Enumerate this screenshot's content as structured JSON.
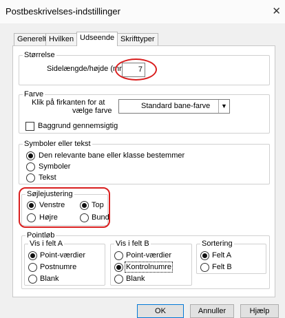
{
  "window": {
    "title": "Postbeskrivelses-indstillinger",
    "close_glyph": "✕"
  },
  "tabs": [
    {
      "label": "Generelt",
      "active": false
    },
    {
      "label": "Hvilken",
      "active": false
    },
    {
      "label": "Udseende",
      "active": true
    },
    {
      "label": "Skrifttyper",
      "active": false
    }
  ],
  "size_group": {
    "legend": "Størrelse",
    "side_label": "Sidelængde/højde (mm)",
    "side_value": "7"
  },
  "color_group": {
    "legend": "Farve",
    "click_label_line1": "Klik på firkanten for at",
    "click_label_line2": "vælge farve",
    "swatch_color": "#b5367e",
    "color_option": "Standard bane-farve",
    "transparent_label": "Baggrund gennemsigtig",
    "transparent_checked": false
  },
  "symbols_group": {
    "legend": "Symboler eller tekst",
    "options": [
      {
        "label": "Den relevante bane eller klasse bestemmer",
        "checked": true
      },
      {
        "label": "Symboler",
        "checked": false
      },
      {
        "label": "Tekst",
        "checked": false
      }
    ]
  },
  "align_group": {
    "legend": "Søjlejustering",
    "options": [
      {
        "label": "Venstre",
        "checked": true
      },
      {
        "label": "Top",
        "checked": true
      },
      {
        "label": "Højre",
        "checked": false
      },
      {
        "label": "Bund",
        "checked": false
      }
    ]
  },
  "course_group": {
    "legend": "Pointløb",
    "field_a": {
      "legend": "Vis i felt A",
      "options": [
        {
          "label": "Point-værdier",
          "checked": true
        },
        {
          "label": "Postnumre",
          "checked": false
        },
        {
          "label": "Blank",
          "checked": false
        }
      ]
    },
    "field_b": {
      "legend": "Vis i felt B",
      "options": [
        {
          "label": "Point-værdier",
          "checked": false
        },
        {
          "label": "Kontrolnumre",
          "checked": true
        },
        {
          "label": "Blank",
          "checked": false
        }
      ]
    },
    "sort": {
      "legend": "Sortering",
      "options": [
        {
          "label": "Felt A",
          "checked": true
        },
        {
          "label": "Felt B",
          "checked": false
        }
      ]
    }
  },
  "buttons": {
    "ok": "OK",
    "cancel": "Annuller",
    "help": "Hjælp"
  },
  "accent_colors": {
    "highlight_ring": "#d91e1e",
    "default_button": "#0078d7"
  }
}
